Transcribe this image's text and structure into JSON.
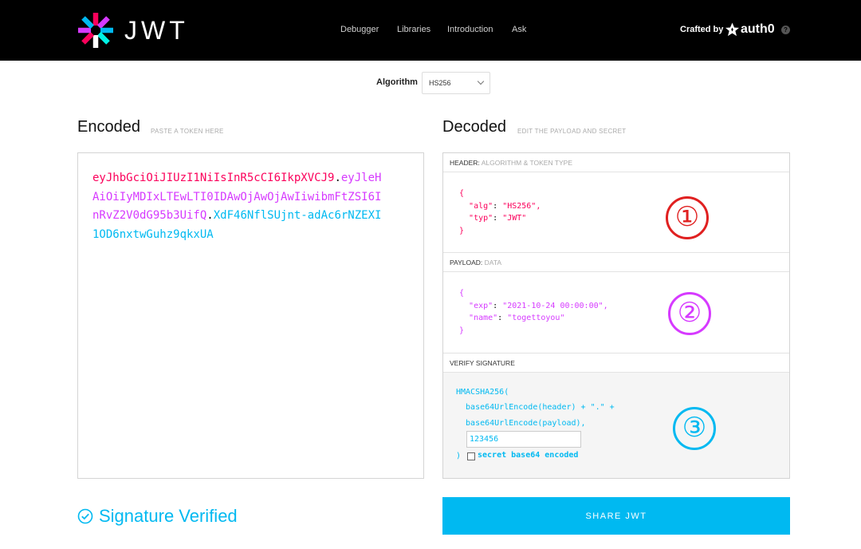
{
  "header": {
    "logo_text": "JWT",
    "nav": [
      "Debugger",
      "Libraries",
      "Introduction",
      "Ask"
    ],
    "crafted_by": "Crafted by",
    "brand": "auth0",
    "help": "?"
  },
  "algorithm": {
    "label": "Algorithm",
    "selected": "HS256"
  },
  "encoded": {
    "title": "Encoded",
    "subtitle": "PASTE A TOKEN HERE",
    "token_header": "eyJhbGciOiJIUzI1NiIsInR5cCI6IkpXVCJ9",
    "token_payload": "eyJleHAiOiIyMDIxLTEwLTI0IDAwOjAwOjAwIiwibmFtZSI6InRvZ2V0dG95b3UifQ",
    "token_signature": "XdF46NflSUjnt-adAc6rNZEXI1OD6nxtwGuhz9qkxUA",
    "dot": "."
  },
  "decoded": {
    "title": "Decoded",
    "subtitle": "EDIT THE PAYLOAD AND SECRET",
    "header_pane": {
      "label": "HEADER:",
      "muted": "ALGORITHM & TOKEN TYPE",
      "alg_key": "\"alg\"",
      "alg_val": "\"HS256\"",
      "typ_key": "\"typ\"",
      "typ_val": "\"JWT\""
    },
    "payload_pane": {
      "label": "PAYLOAD:",
      "muted": "DATA",
      "exp_key": "\"exp\"",
      "exp_val": "\"2021-10-24 00:00:00\"",
      "name_key": "\"name\"",
      "name_val": "\"togettoyou\""
    },
    "verify_pane": {
      "label": "VERIFY SIGNATURE",
      "line1": "HMACSHA256(",
      "line2": "  base64UrlEncode(header) + \".\" +",
      "line3": "  base64UrlEncode(payload),",
      "secret": "123456",
      "close": ")",
      "checkbox_label": "secret base64 encoded"
    },
    "annotations": [
      "①",
      "②",
      "③"
    ]
  },
  "footer": {
    "verified": "Signature Verified",
    "share": "SHARE JWT"
  },
  "colors": {
    "header": "#fb015b",
    "payload": "#d63aff",
    "signature": "#00b9f1"
  }
}
